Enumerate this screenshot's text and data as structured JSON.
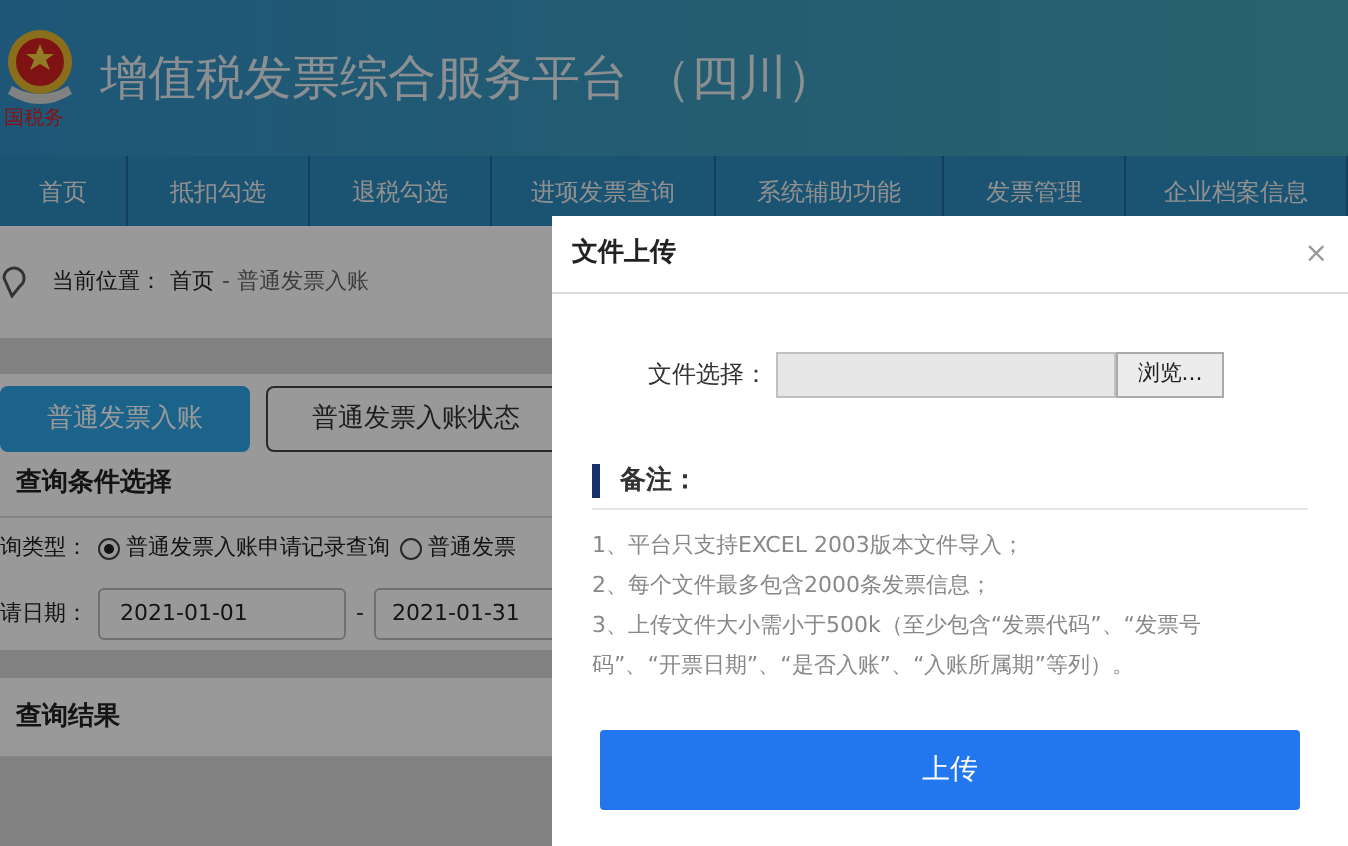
{
  "header": {
    "logo_text": "国税务",
    "title": "增值税发票综合服务平台 （四川）"
  },
  "nav": [
    {
      "label": "首页"
    },
    {
      "label": "抵扣勾选"
    },
    {
      "label": "退税勾选"
    },
    {
      "label": "进项发票查询"
    },
    {
      "label": "系统辅助功能"
    },
    {
      "label": "发票管理"
    },
    {
      "label": "企业档案信息"
    }
  ],
  "breadcrumb": {
    "label": "当前位置：",
    "home": "首页",
    "current": "- 普通发票入账"
  },
  "tabs": [
    {
      "label": "普通发票入账",
      "selected": true
    },
    {
      "label": "普通发票入账状态",
      "selected": false
    }
  ],
  "query": {
    "title": "查询条件选择",
    "type_label": "询类型：",
    "options": [
      {
        "label": "普通发票入账申请记录查询",
        "selected": true
      },
      {
        "label": "普通发票",
        "selected": false
      }
    ],
    "date_label": "请日期：",
    "date_from": "2021-01-01",
    "date_sep": "-",
    "date_to": "2021-01-31"
  },
  "results": {
    "title": "查询结果"
  },
  "dialog": {
    "title": "文件上传",
    "close": "×",
    "file_label": "文件选择：",
    "browse": "浏览...",
    "notes_title": "备注：",
    "notes": [
      "1、平台只支持EXCEL 2003版本文件导入；",
      "2、每个文件最多包含2000条发票信息；",
      "3、上传文件大小需小于500k（至少包含“发票代码”、“发票号码”、“开票日期”、“是否入账”、“入账所属期”等列）。"
    ],
    "upload": "上传"
  }
}
